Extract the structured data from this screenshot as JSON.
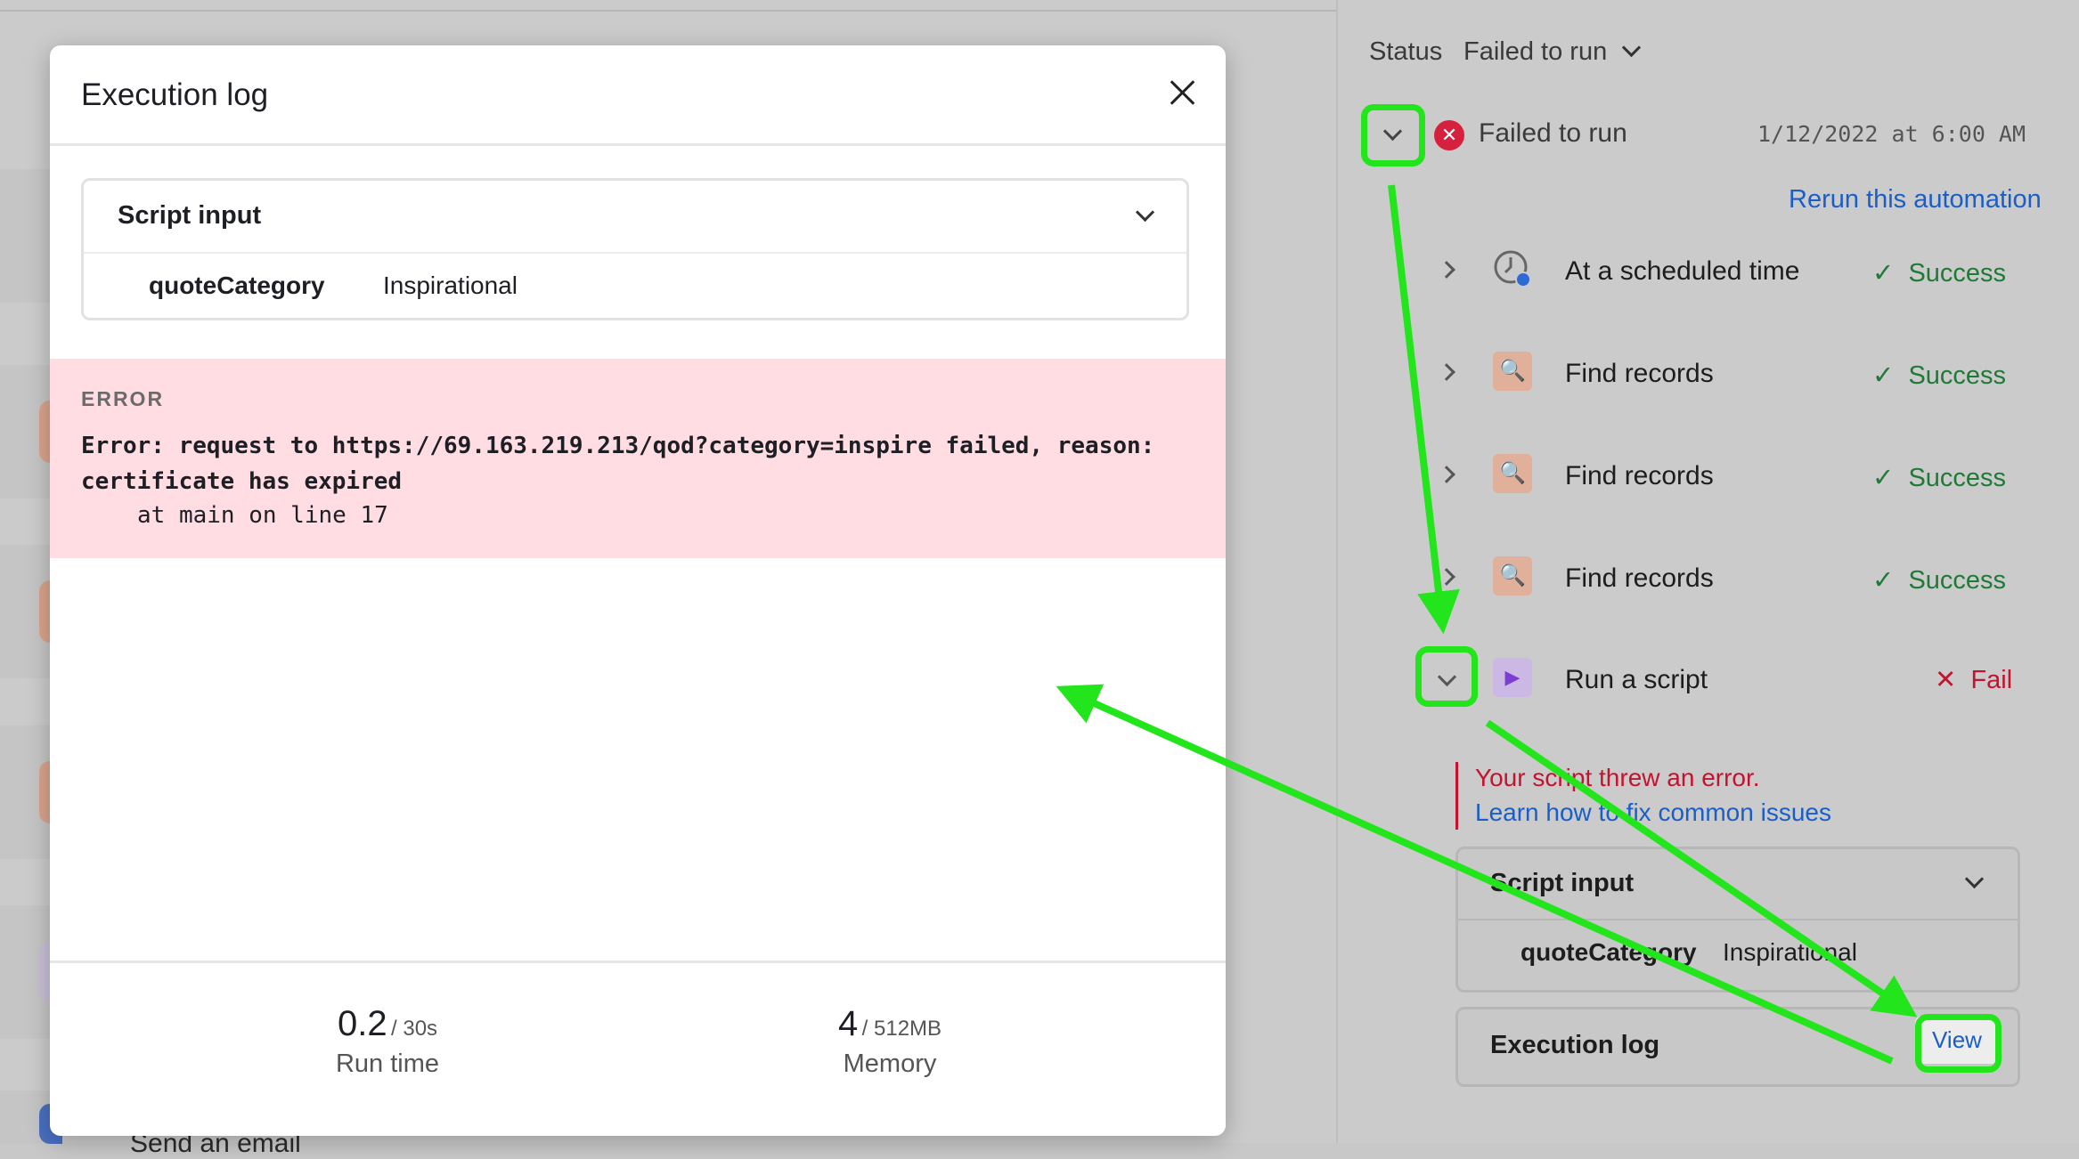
{
  "modal": {
    "title": "Execution log",
    "script_input": {
      "title": "Script input",
      "key": "quoteCategory",
      "value": "Inspirational"
    },
    "error": {
      "label": "ERROR",
      "message": "Error: request to https://69.163.219.213/qod?category=inspire failed, reason: certificate has expired",
      "trace": "at main on line 17"
    },
    "stats": {
      "run_time_value": "0.2",
      "run_time_limit": "/ 30s",
      "run_time_label": "Run time",
      "memory_value": "4",
      "memory_limit": "/ 512MB",
      "memory_label": "Memory"
    }
  },
  "background": {
    "partial_item_text": "Send an email"
  },
  "panel": {
    "status_label": "Status",
    "status_value": "Failed to run",
    "run": {
      "title": "Failed to run",
      "timestamp": "1/12/2022 at 6:00 AM",
      "rerun_link": "Rerun this automation"
    },
    "steps": [
      {
        "name": "At a scheduled time",
        "status": "Success"
      },
      {
        "name": "Find records",
        "status": "Success"
      },
      {
        "name": "Find records",
        "status": "Success"
      },
      {
        "name": "Find records",
        "status": "Success"
      },
      {
        "name": "Run a script",
        "status": "Fail"
      }
    ],
    "script_error": {
      "message": "Your script threw an error.",
      "link": "Learn how to fix common issues"
    },
    "script_input": {
      "title": "Script input",
      "key": "quoteCategory",
      "value": "Inspirational"
    },
    "execution_log": {
      "title": "Execution log",
      "button": "View"
    }
  },
  "colors": {
    "annotation": "#22e51c",
    "error_red": "#c4132f",
    "success_green": "#1f7a36",
    "link_blue": "#1a5ec8",
    "error_bg": "#ffdde3"
  }
}
